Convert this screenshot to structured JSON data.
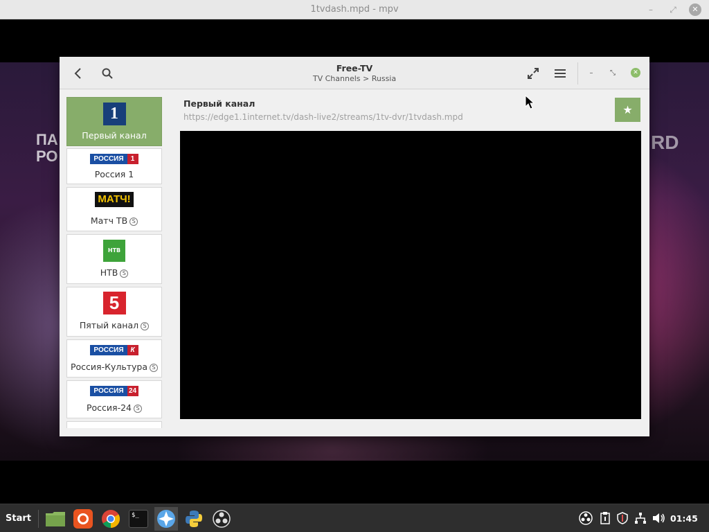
{
  "mpv": {
    "title": "1tvdash.mpd - mpv",
    "overlay_left": "ПА\nРО",
    "overlay_right": "RD"
  },
  "app": {
    "title": "Free-TV",
    "subtitle": "TV Channels > Russia",
    "accent_color": "#87ad6a"
  },
  "sidebar": {
    "channels": [
      {
        "label": "Первый канал",
        "logo_text": "1",
        "subscription": false,
        "selected": true
      },
      {
        "label": "Россия 1",
        "logo_text": "РОССИЯ",
        "logo_num": "1",
        "subscription": false
      },
      {
        "label": "Матч ТВ",
        "logo_text": "МАТЧ!",
        "subscription": true
      },
      {
        "label": "НТВ",
        "logo_text": "НТВ",
        "subscription": true
      },
      {
        "label": "Пятый канал",
        "logo_text": "5",
        "subscription": true
      },
      {
        "label": "Россия-Культура",
        "logo_text": "РОССИЯ",
        "logo_num": "К",
        "subscription": true
      },
      {
        "label": "Россия-24",
        "logo_text": "РОССИЯ",
        "logo_num": "24",
        "subscription": true
      }
    ]
  },
  "main": {
    "stream_title": "Первый канал",
    "stream_url": "https://edge1.1internet.tv/dash-live2/streams/1tv-dvr/1tvdash.mpd",
    "favorite_icon": "star-icon"
  },
  "taskbar": {
    "start_label": "Start",
    "subscription_badge": "S",
    "clock": "01:45"
  }
}
